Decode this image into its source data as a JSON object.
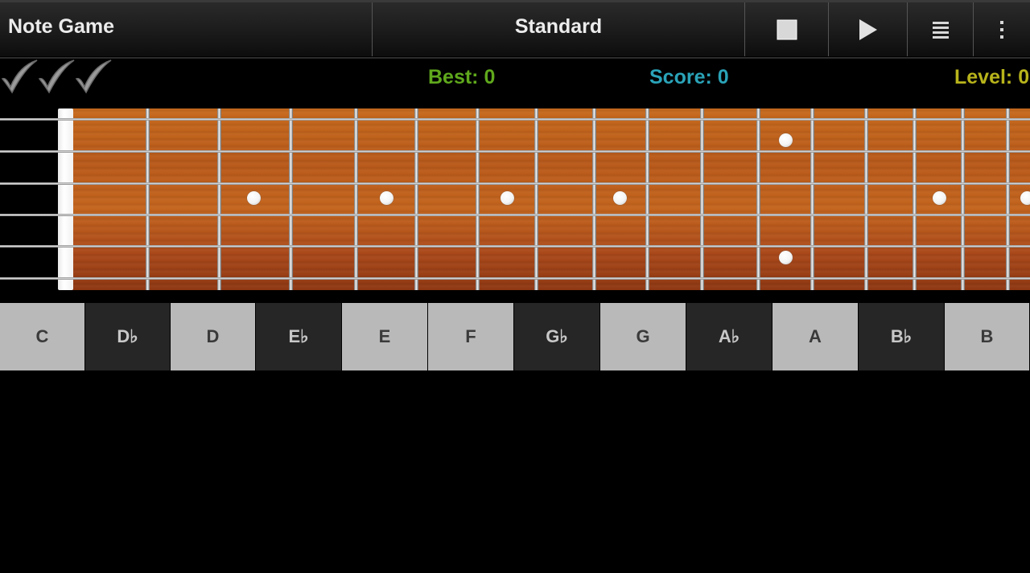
{
  "actionbar": {
    "app_title": "Note Game",
    "mode_title": "Standard",
    "buttons": [
      {
        "name": "stop-button",
        "icon": "stop-icon"
      },
      {
        "name": "play-button",
        "icon": "play-icon"
      },
      {
        "name": "list-button",
        "icon": "list-icon"
      },
      {
        "name": "overflow-menu-button",
        "icon": "more-vert-icon"
      }
    ]
  },
  "status": {
    "checks_remaining": 3,
    "best": "Best: 0",
    "score": "Score: 0",
    "level": "Level: 0",
    "colors": {
      "best": "#5fa81c",
      "score": "#2aa3b8",
      "level": "#b8b41b"
    }
  },
  "fretboard": {
    "strings": 6,
    "frets_visible": 15,
    "single_inlay_frets": [
      3,
      5,
      7,
      9,
      15,
      17
    ],
    "double_inlay_frets": [
      12
    ]
  },
  "notes": [
    {
      "label": "C",
      "type": "natural"
    },
    {
      "label": "D♭",
      "type": "flat"
    },
    {
      "label": "D",
      "type": "natural"
    },
    {
      "label": "E♭",
      "type": "flat"
    },
    {
      "label": "E",
      "type": "natural"
    },
    {
      "label": "F",
      "type": "natural"
    },
    {
      "label": "G♭",
      "type": "flat"
    },
    {
      "label": "G",
      "type": "natural"
    },
    {
      "label": "A♭",
      "type": "flat"
    },
    {
      "label": "A",
      "type": "natural"
    },
    {
      "label": "B♭",
      "type": "flat"
    },
    {
      "label": "B",
      "type": "natural"
    }
  ]
}
